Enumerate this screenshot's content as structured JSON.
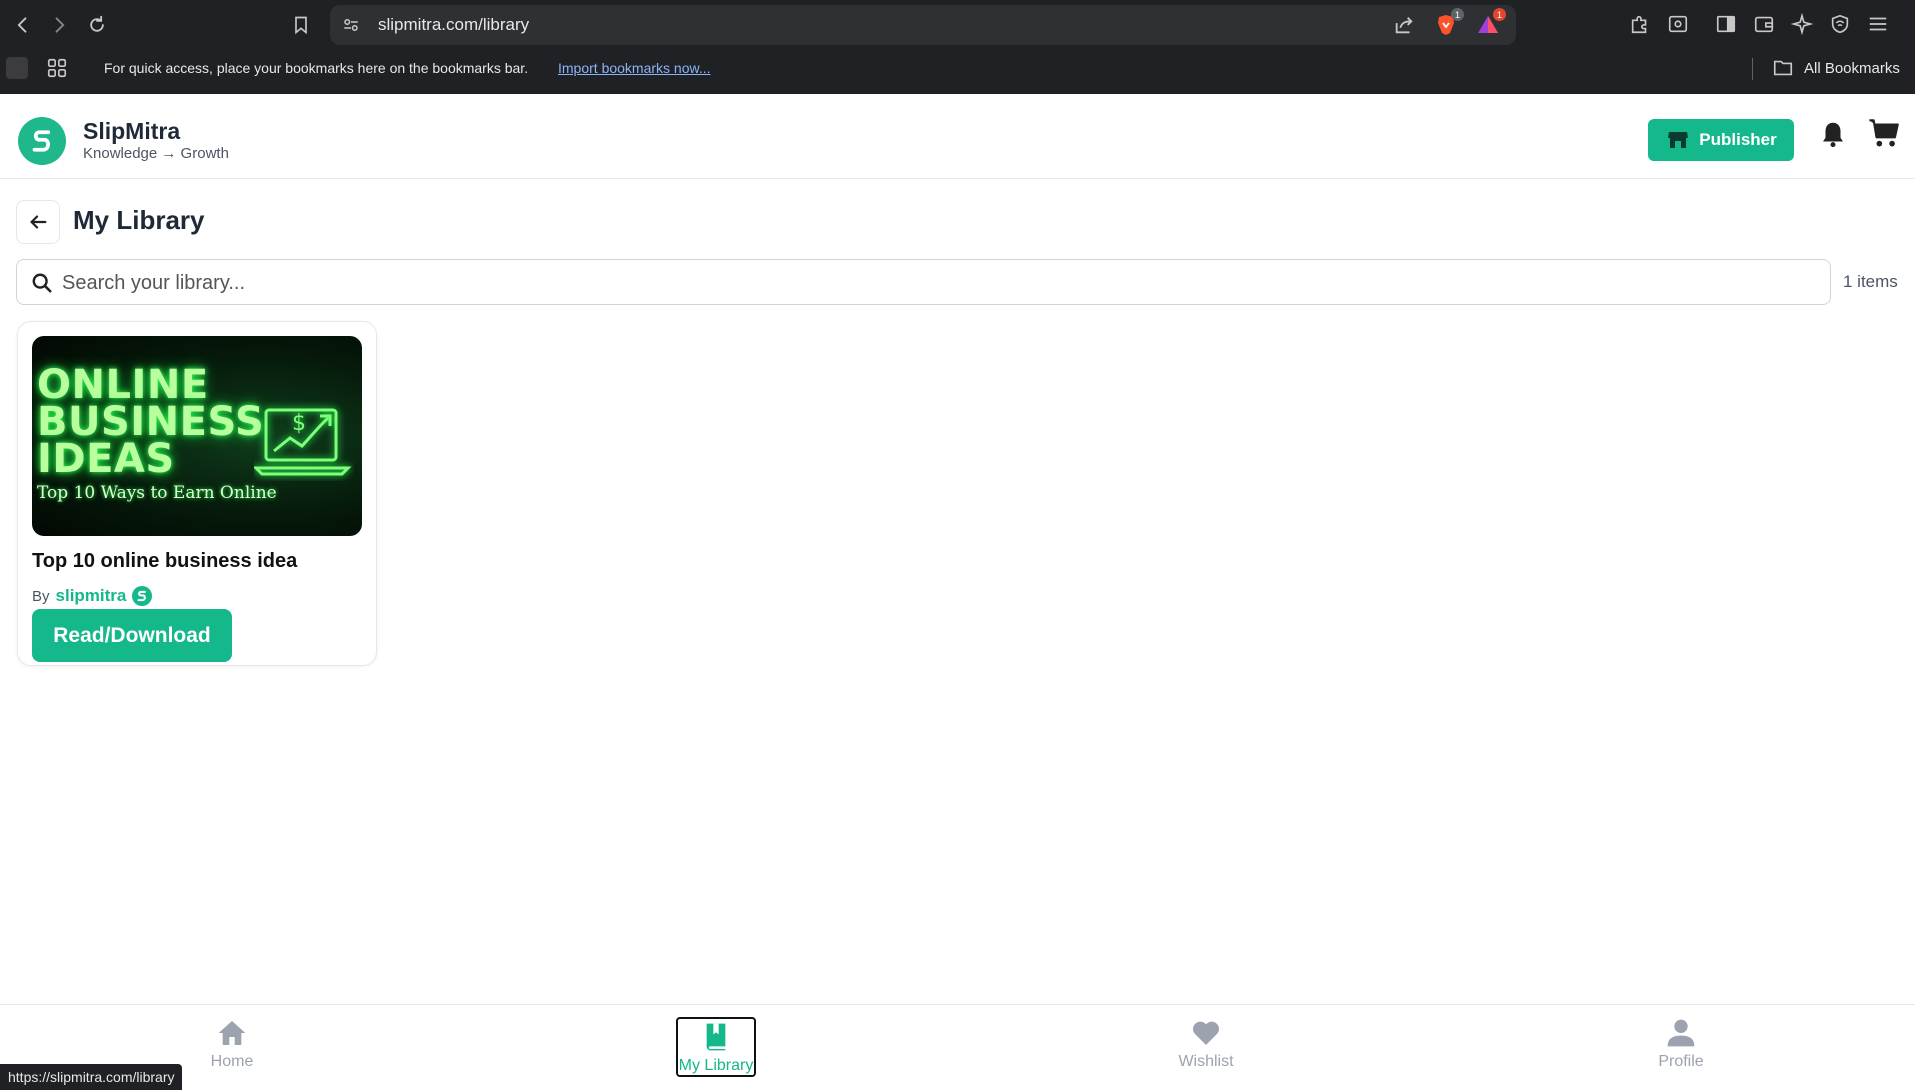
{
  "browser": {
    "url": "slipmitra.com/library",
    "bookmarks_prompt": "For quick access, place your bookmarks here on the bookmarks bar.",
    "import_link": "Import bookmarks now...",
    "all_bookmarks": "All Bookmarks",
    "brave_badge": "1",
    "rewards_badge": "1",
    "status_url": "https://slipmitra.com/library"
  },
  "header": {
    "brand": "SlipMitra",
    "tagline": "Knowledge → Growth",
    "publisher_label": "Publisher"
  },
  "page": {
    "title": "My Library",
    "search_placeholder": "Search your library...",
    "items_count": "1 items"
  },
  "library": {
    "items": [
      {
        "cover_lines": [
          "ONLINE",
          "BUSINESS",
          "IDEAS"
        ],
        "cover_subtitle": "Top 10 Ways to Earn Online",
        "title": "Top 10 online business idea",
        "by_label": "By",
        "author": "slipmitra",
        "action_label": "Read/Download"
      }
    ]
  },
  "bottom_nav": {
    "items": [
      {
        "label": "Home",
        "icon": "home-icon"
      },
      {
        "label": "My Library",
        "icon": "book-icon",
        "active": true
      },
      {
        "label": "Wishlist",
        "icon": "heart-icon"
      },
      {
        "label": "Profile",
        "icon": "user-icon"
      }
    ]
  },
  "colors": {
    "accent": "#14b88b",
    "browser_chrome": "#202124",
    "cover_glow": "#2aff52"
  }
}
